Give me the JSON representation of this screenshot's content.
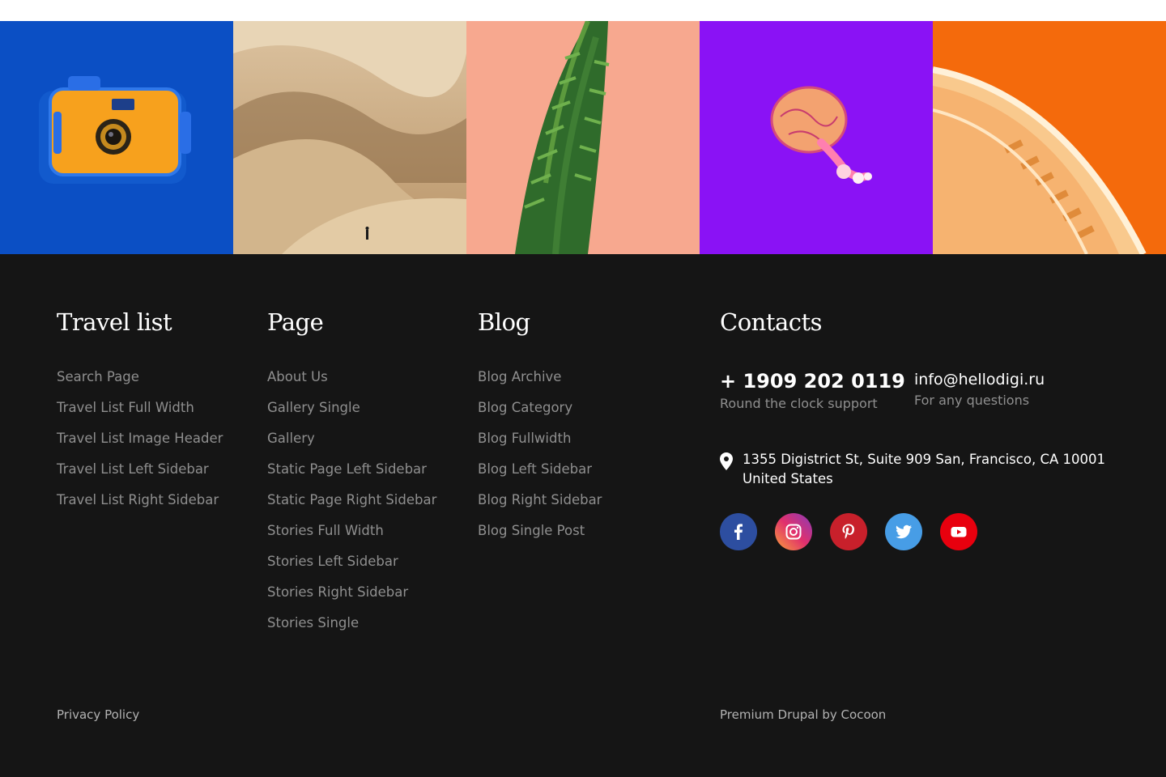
{
  "gallery": {
    "tiles": [
      {
        "name": "camera-photo",
        "bg": "#0b4fc4"
      },
      {
        "name": "desert-dunes-photo",
        "bg": "#c9a97a"
      },
      {
        "name": "plant-photo",
        "bg": "#f7a88f"
      },
      {
        "name": "jellyfish-photo",
        "bg": "#8a12f5"
      },
      {
        "name": "orange-stairs-photo",
        "bg": "#f46a0c"
      }
    ]
  },
  "footer": {
    "travel_list": {
      "title": "Travel list",
      "links": [
        "Search Page",
        "Travel List Full Width",
        "Travel List Image Header",
        "Travel List Left Sidebar",
        "Travel List Right Sidebar"
      ]
    },
    "page": {
      "title": "Page",
      "links": [
        "About Us",
        "Gallery Single",
        "Gallery",
        "Static Page Left Sidebar",
        "Static Page Right Sidebar",
        "Stories Full Width",
        "Stories Left Sidebar",
        "Stories Right Sidebar",
        "Stories Single"
      ]
    },
    "blog": {
      "title": "Blog",
      "links": [
        "Blog Archive",
        "Blog Category",
        "Blog Fullwidth",
        "Blog Left Sidebar",
        "Blog Right Sidebar",
        "Blog Single Post"
      ]
    },
    "contacts": {
      "title": "Contacts",
      "phone": "+ 1909 202 0119",
      "phone_note": "Round the clock support",
      "email": "info@hellodigi.ru",
      "email_note": "For any questions",
      "address_line1": "1355 Digistrict St, Suite 909 San, Francisco, CA 10001",
      "address_line2": "United States",
      "socials": [
        {
          "icon": "facebook-icon",
          "color": "#2d4ea0"
        },
        {
          "icon": "instagram-icon",
          "color": "#c13584"
        },
        {
          "icon": "pinterest-icon",
          "color": "#c8202b"
        },
        {
          "icon": "twitter-icon",
          "color": "#479de6"
        },
        {
          "icon": "youtube-icon",
          "color": "#e8000e"
        }
      ]
    },
    "privacy": "Privacy Policy",
    "credit": "Premium Drupal by Cocoon"
  }
}
